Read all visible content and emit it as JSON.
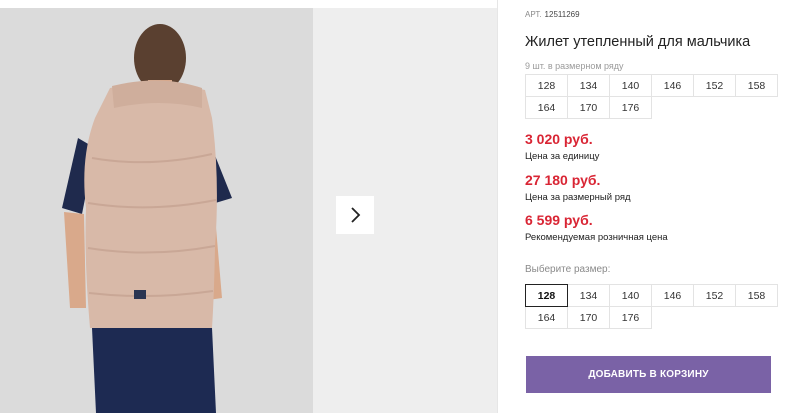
{
  "gallery": {
    "photo_alt": "boy wearing beige puffer vest, back view",
    "next_icon": "chevron-right-icon"
  },
  "product": {
    "sku_label": "АРТ.",
    "sku_value": "12511269",
    "title": "Жилет утепленный для мальчика",
    "pack_note": "9 шт. в размерном ряду",
    "pack_sizes": [
      "128",
      "134",
      "140",
      "146",
      "152",
      "158",
      "164",
      "170",
      "176"
    ]
  },
  "prices": {
    "unit_price": "3 020 руб.",
    "unit_label": "Цена за единицу",
    "pack_price": "27 180 руб.",
    "pack_label": "Цена за размерный ряд",
    "retail_price": "6 599 руб.",
    "retail_label": "Рекомендуемая розничная цена",
    "accent_color": "#d92534"
  },
  "size_select": {
    "label": "Выберите размер:",
    "options": [
      "128",
      "134",
      "140",
      "146",
      "152",
      "158",
      "164",
      "170",
      "176"
    ],
    "selected": "128"
  },
  "cart": {
    "button_label": "ДОБАВИТЬ В КОРЗИНУ",
    "button_color": "#7a62a6"
  }
}
